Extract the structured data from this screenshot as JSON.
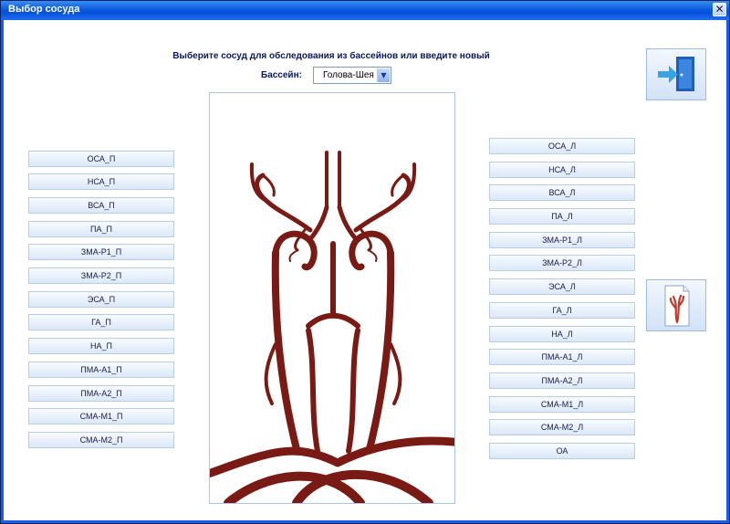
{
  "window": {
    "title": "Выбор сосуда",
    "close_glyph": "✕"
  },
  "prompt": "Выберите сосуд для обследования из бассейнов или введите новый",
  "basin": {
    "label": "Бассейн:",
    "value": "Голова-Шея"
  },
  "left_vessels": [
    "ОСА_П",
    "НСА_П",
    "ВСА_П",
    "ПА_П",
    "ЗМА-Р1_П",
    "ЗМА-Р2_П",
    "ЭСА_П",
    "ГА_П",
    "НА_П",
    "ПМА-А1_П",
    "ПМА-А2_П",
    "СМА-М1_П",
    "СМА-М2_П"
  ],
  "right_vessels": [
    "ОСА_Л",
    "НСА_Л",
    "ВСА_Л",
    "ПА_Л",
    "ЗМА-Р1_Л",
    "ЗМА-Р2_Л",
    "ЭСА_Л",
    "ГА_Л",
    "НА_Л",
    "ПМА-А1_Л",
    "ПМА-А2_Л",
    "СМА-М1_Л",
    "СМА-М2_Л",
    "ОА"
  ],
  "icons": {
    "exit": "exit-door-icon",
    "report": "report-document-icon"
  },
  "colors": {
    "artery": "#7a1a14",
    "titlebar": "#0a5ae0",
    "accent": "#3a7fd8"
  }
}
